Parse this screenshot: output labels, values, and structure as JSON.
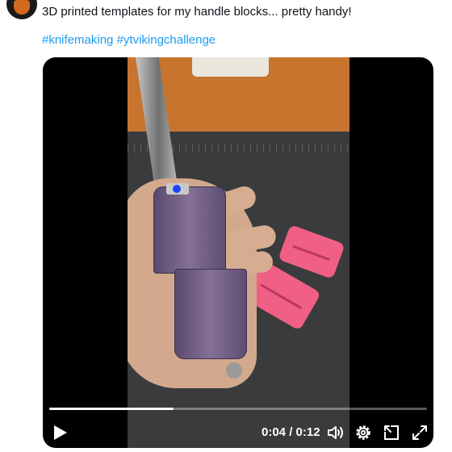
{
  "tweet": {
    "text": "3D printed templates for my handle blocks... pretty handy!",
    "hashtags": [
      "#knifemaking",
      "#ytvikingchallenge"
    ]
  },
  "video": {
    "current_time": "0:04",
    "separator": " / ",
    "duration": "0:12",
    "progress_fraction": 0.33,
    "controls": [
      "play-icon",
      "volume-icon",
      "settings-icon",
      "picture-in-picture-icon",
      "fullscreen-icon"
    ]
  },
  "colors": {
    "link": "#1d9bf0",
    "template_pink": "#ef5f86",
    "handle_purple": "#6e5a84"
  }
}
